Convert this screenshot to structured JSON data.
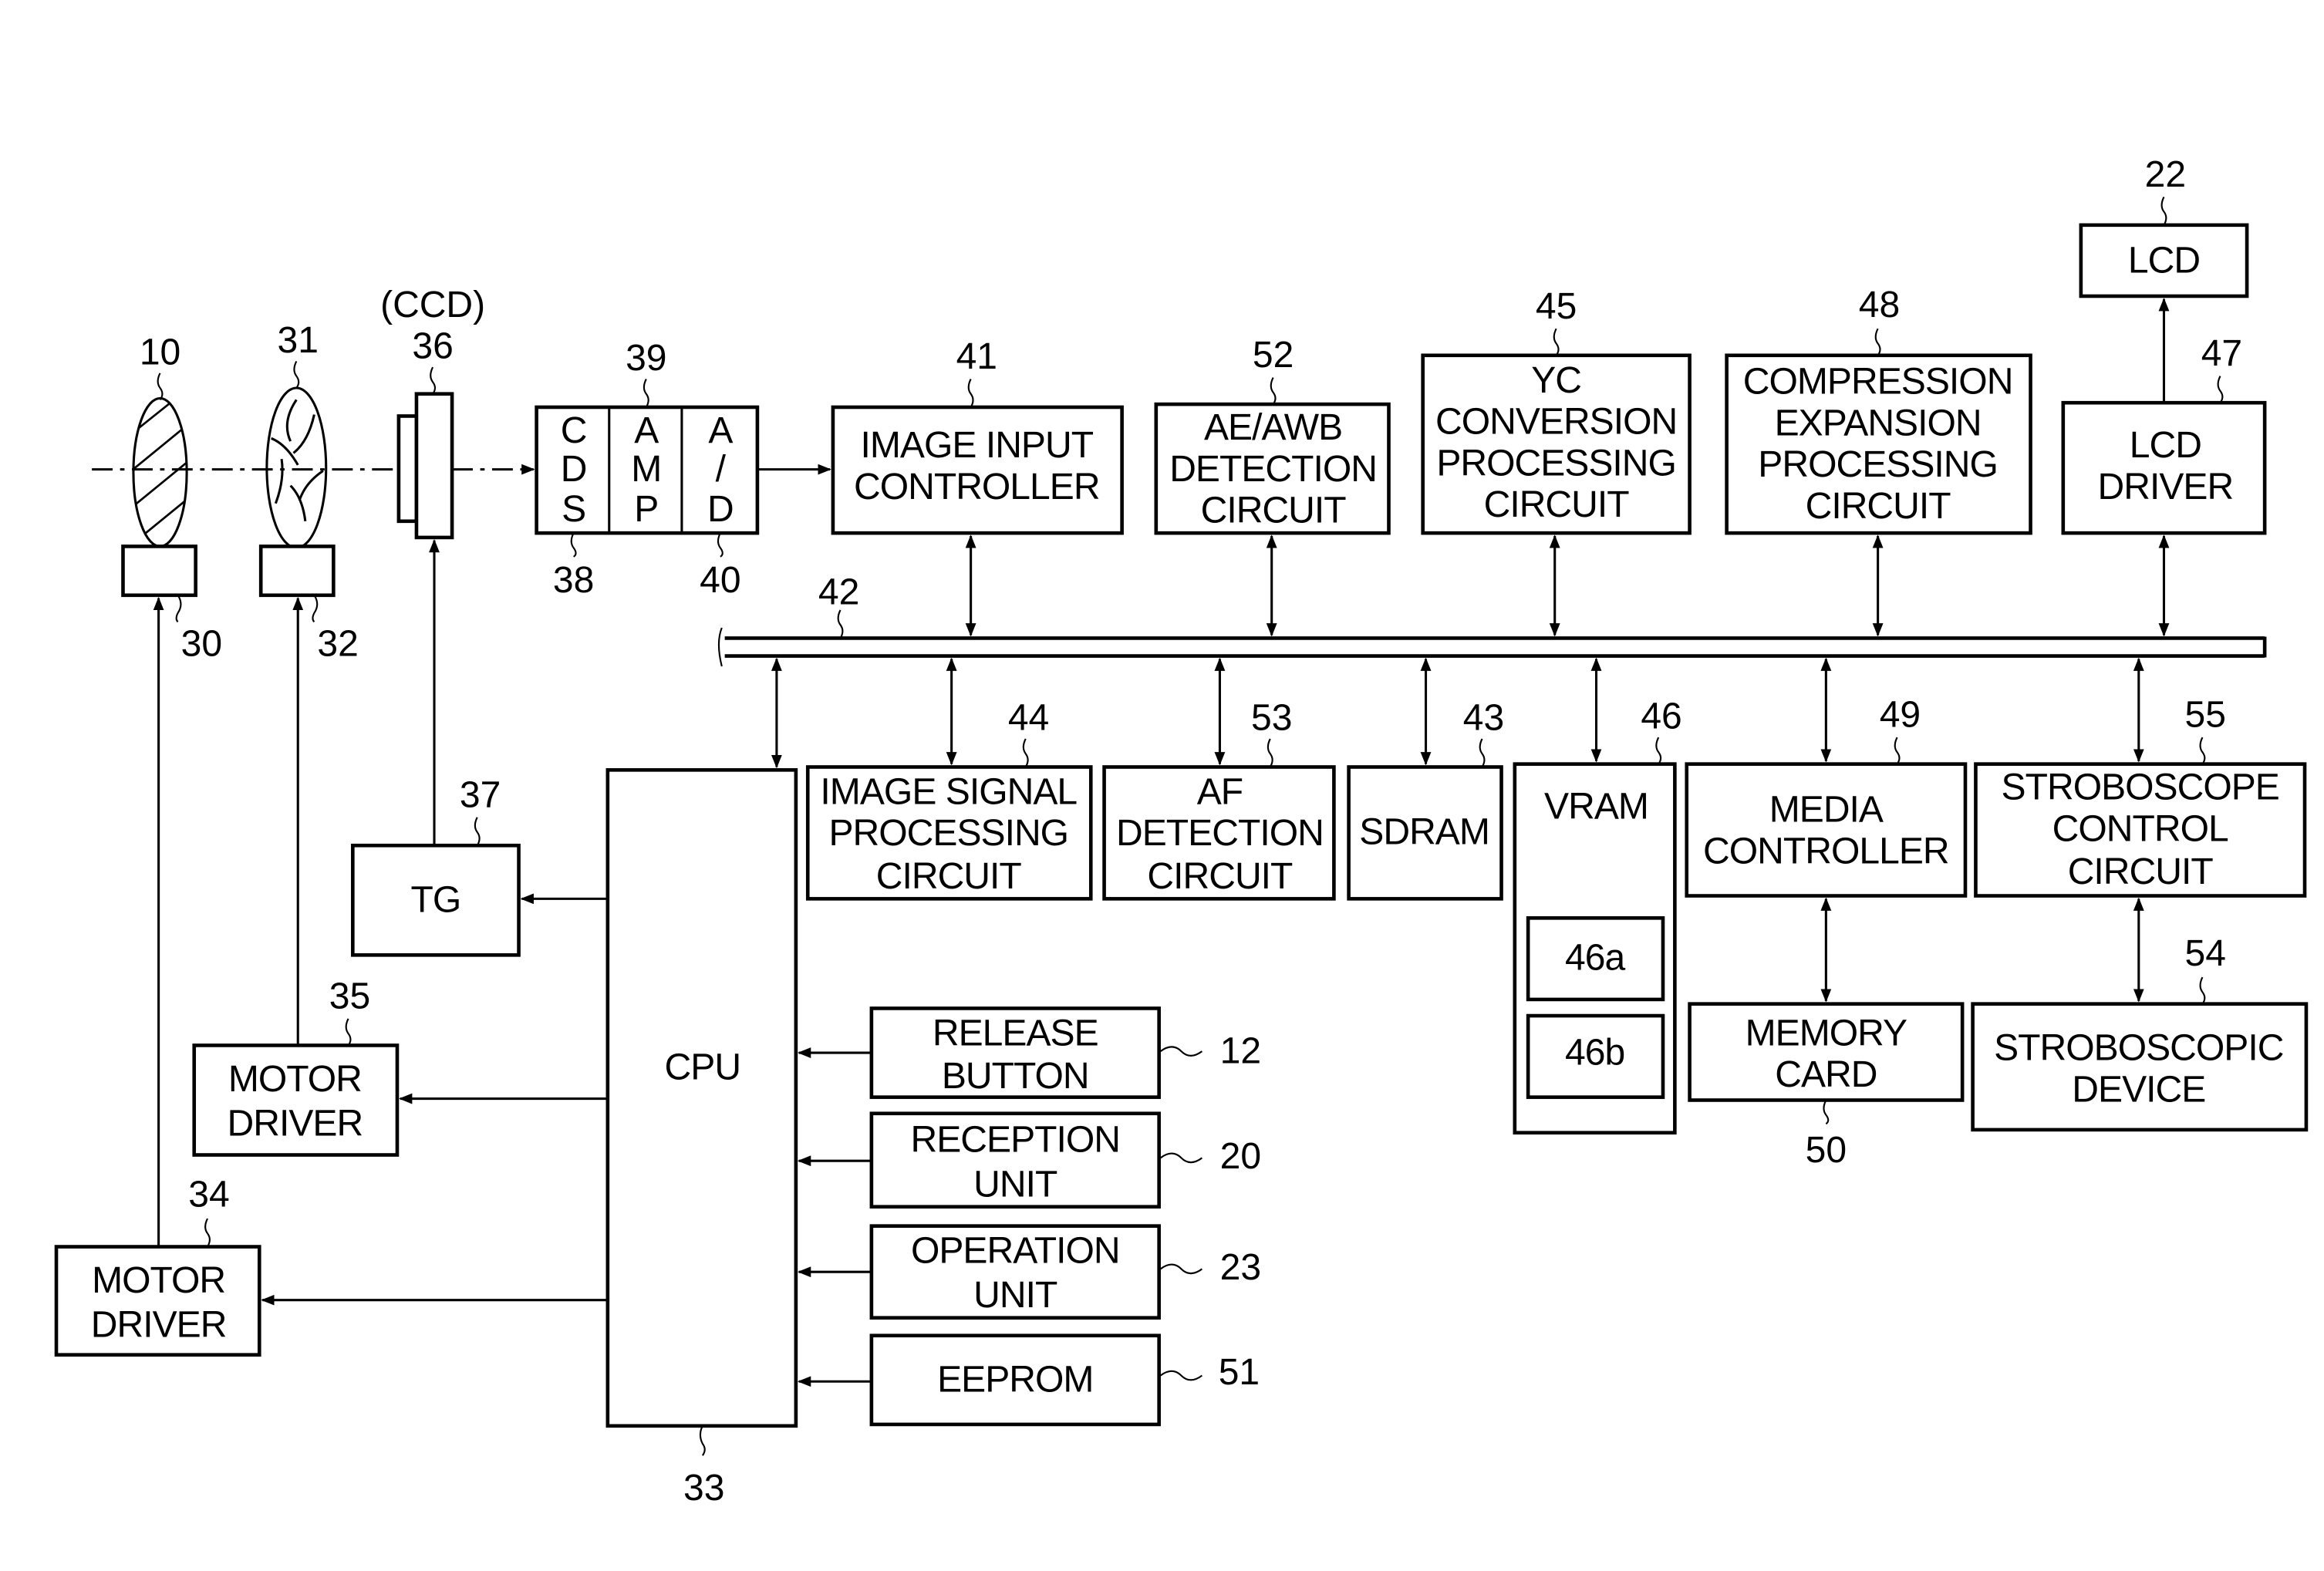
{
  "figure": {
    "optical": {
      "lens": {
        "ref": "10",
        "motor_ref": "30"
      },
      "iris": {
        "ref": "31",
        "motor_ref": "32"
      },
      "ccd": {
        "ref": "36",
        "caption": "(CCD)"
      }
    },
    "analog_frontend": {
      "ref_group": "39",
      "cds": {
        "ref": "38",
        "letters": [
          "C",
          "D",
          "S"
        ]
      },
      "amp": {
        "letters": [
          "A",
          "M",
          "P"
        ]
      },
      "ad": {
        "ref": "40",
        "letters": [
          "A",
          "/",
          "D"
        ]
      }
    },
    "bus": {
      "ref": "42"
    },
    "upper_blocks": [
      {
        "id": "image-input-controller",
        "ref": "41",
        "lines": [
          "IMAGE INPUT",
          "CONTROLLER"
        ]
      },
      {
        "id": "ae-awb-detection-circuit",
        "ref": "52",
        "lines": [
          "AE/AWB",
          "DETECTION",
          "CIRCUIT"
        ]
      },
      {
        "id": "yc-conversion-processing-circuit",
        "ref": "45",
        "lines": [
          "YC",
          "CONVERSION",
          "PROCESSING",
          "CIRCUIT"
        ]
      },
      {
        "id": "compression-expansion-processing-circuit",
        "ref": "48",
        "lines": [
          "COMPRESSION",
          "EXPANSION",
          "PROCESSING",
          "CIRCUIT"
        ]
      },
      {
        "id": "lcd-driver",
        "ref": "47",
        "lines": [
          "LCD",
          "DRIVER"
        ]
      }
    ],
    "lcd": {
      "ref": "22",
      "label": "LCD"
    },
    "lower_blocks": [
      {
        "id": "image-signal-processing-circuit",
        "ref": "44",
        "lines": [
          "IMAGE SIGNAL",
          "PROCESSING",
          "CIRCUIT"
        ]
      },
      {
        "id": "af-detection-circuit",
        "ref": "53",
        "lines": [
          "AF",
          "DETECTION",
          "CIRCUIT"
        ]
      },
      {
        "id": "sdram",
        "ref": "43",
        "lines": [
          "SDRAM"
        ]
      },
      {
        "id": "vram",
        "ref": "46",
        "lines": [
          "VRAM"
        ],
        "sub_areas": [
          "46a",
          "46b"
        ]
      },
      {
        "id": "media-controller",
        "ref": "49",
        "lines": [
          "MEDIA",
          "CONTROLLER"
        ]
      },
      {
        "id": "stroboscope-control-circuit",
        "ref": "55",
        "lines": [
          "STROBOSCOPE",
          "CONTROL",
          "CIRCUIT"
        ]
      }
    ],
    "memory_card": {
      "ref": "50",
      "lines": [
        "MEMORY",
        "CARD"
      ]
    },
    "stroboscopic_device": {
      "ref": "54",
      "lines": [
        "STROBOSCOPIC",
        "DEVICE"
      ]
    },
    "cpu": {
      "ref": "33",
      "label": "CPU"
    },
    "tg": {
      "ref": "37",
      "label": "TG"
    },
    "motor_driver_iris": {
      "ref": "35",
      "lines": [
        "MOTOR",
        "DRIVER"
      ]
    },
    "motor_driver_lens": {
      "ref": "34",
      "lines": [
        "MOTOR",
        "DRIVER"
      ]
    },
    "inputs": [
      {
        "id": "release-button",
        "ref": "12",
        "lines": [
          "RELEASE",
          "BUTTON"
        ]
      },
      {
        "id": "reception-unit",
        "ref": "20",
        "lines": [
          "RECEPTION",
          "UNIT"
        ]
      },
      {
        "id": "operation-unit",
        "ref": "23",
        "lines": [
          "OPERATION",
          "UNIT"
        ]
      },
      {
        "id": "eeprom",
        "ref": "51",
        "lines": [
          "EEPROM"
        ]
      }
    ]
  }
}
